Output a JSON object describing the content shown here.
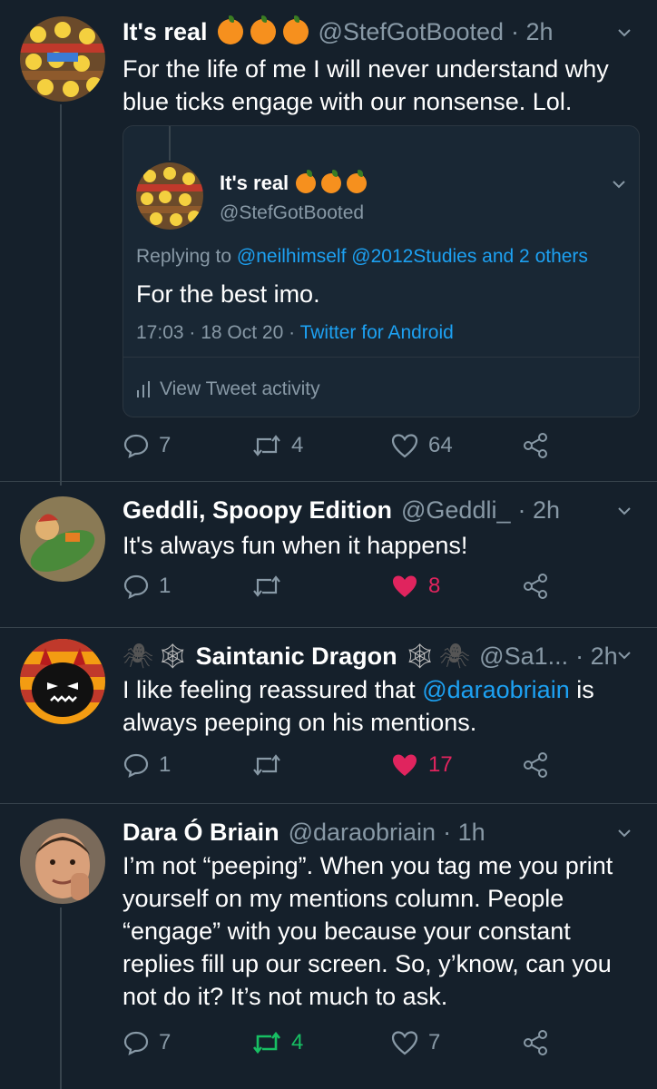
{
  "colors": {
    "background": "#15202b",
    "text": "#ffffff",
    "muted": "#8899a6",
    "link": "#1da1f2",
    "like_active": "#e0245e",
    "retweet_active": "#17bf63",
    "emoji_orange": "#f6901e"
  },
  "tweet1": {
    "name": "It's real",
    "name_emojis": [
      "orange",
      "orange",
      "orange"
    ],
    "handle": "@StefGotBooted",
    "time": "· 2h",
    "text": [
      "For the life of me I will never understand why",
      "blue ticks engage with our nonsense. Lol."
    ],
    "quoted": {
      "name": "It's real",
      "handle": "@StefGotBooted",
      "replying_prefix": "Replying to",
      "replying_to": "@neilhimself @2012Studies and 2 others",
      "text": "For the best imo.",
      "meta_time": "17:03 · 18 Oct 20 ·",
      "meta_source": "Twitter for Android",
      "activity": "View Tweet activity"
    },
    "actions": {
      "reply": "7",
      "retweet": "4",
      "like": "64"
    }
  },
  "tweet2": {
    "name": "Geddli, Spoopy Edition",
    "handle": "@Geddli_",
    "time": "· 2h",
    "text": "It's always fun when it happens!",
    "actions": {
      "reply": "1",
      "retweet": "",
      "like": "8"
    }
  },
  "tweet3": {
    "name": "Saintanic Dragon",
    "name_emojis": [
      "spider",
      "spider-web",
      "spider-web",
      "spider"
    ],
    "handle": "@Sa1...",
    "time": "· 2h",
    "text_before": "I like feeling reassured that",
    "mention": "@daraobriain",
    "text_after": "is",
    "text_line2": "always peeping on his mentions.",
    "actions": {
      "reply": "1",
      "retweet": "",
      "like": "17"
    }
  },
  "tweet4": {
    "name": "Dara Ó Briain",
    "handle": "@daraobriain",
    "time": "· 1h",
    "text": [
      "I’m not “peeping”. When you tag me you print",
      "yourself on my mentions column. People",
      "“engage” with you because your constant",
      "replies fill up our screen. So, y’know, can you",
      "not do it? It’s not much to ask."
    ],
    "actions": {
      "reply": "7",
      "retweet": "4",
      "like": "7"
    }
  },
  "icons": [
    "reply-icon",
    "retweet-icon",
    "like-icon",
    "share-icon",
    "chevron-down-icon",
    "activity-icon"
  ]
}
